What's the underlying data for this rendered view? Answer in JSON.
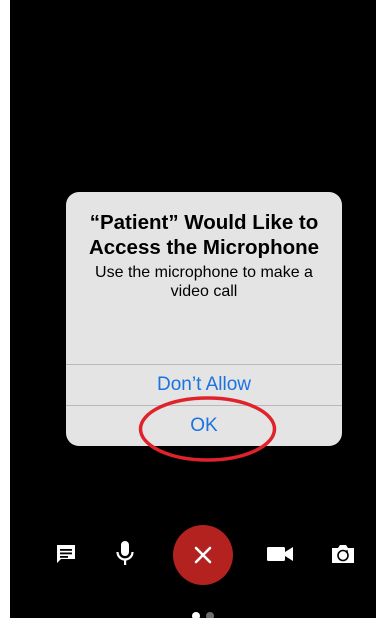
{
  "dialog": {
    "title": "“Patient” Would Like to Access the Microphone",
    "message": "Use the microphone to make a video call",
    "deny_label": "Don’t Allow",
    "ok_label": "OK"
  },
  "toolbar": {
    "items": [
      {
        "icon": "chat-icon"
      },
      {
        "icon": "microphone-icon"
      },
      {
        "icon": "end-call-icon"
      },
      {
        "icon": "video-camera-icon"
      },
      {
        "icon": "switch-camera-icon"
      }
    ]
  },
  "colors": {
    "background": "#000000",
    "dialog": "#e4e4e4",
    "button_text": "#1a73e0",
    "end_call": "#b3221f",
    "highlight": "#e0232a"
  },
  "page_indicator": {
    "count": 2,
    "active": 1
  }
}
